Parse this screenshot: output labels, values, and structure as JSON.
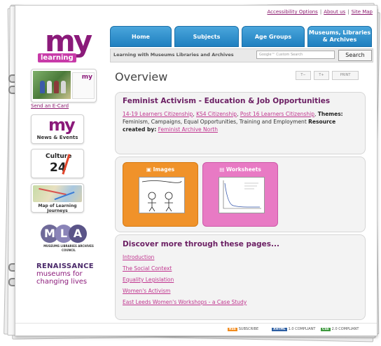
{
  "utility": {
    "accessibility": "Accessibility Options",
    "about": "About us",
    "sitemap": "Site Map",
    "sep": "|"
  },
  "logo": {
    "m": "my",
    "learning": "learning"
  },
  "sidebar": {
    "ecard_link": "Send an E-Card",
    "news_logo": "my",
    "news_label": "News & Events",
    "culture_top": "Culture",
    "culture_num": "24",
    "map_label": "Map of Learning Journeys",
    "mla_letters": [
      "M",
      "L",
      "A"
    ],
    "mla_sub": "MUSEUMS LIBRARIES ARCHIVES",
    "mla_sub2": "COUNCIL",
    "renaissance_title": "RENAISSANCE",
    "renaissance_line1": "museums for",
    "renaissance_line2": "changing lives"
  },
  "nav": {
    "tabs": [
      "Home",
      "Subjects",
      "Age Groups",
      "Museums, Libraries & Archives"
    ]
  },
  "subbar": {
    "text": "Learning with Museums Libraries and Archives",
    "search_placeholder": "Google™ Custom Search",
    "search_button": "Search"
  },
  "main": {
    "title": "Overview",
    "tools": [
      "T−",
      "T+",
      "PRINT"
    ],
    "resource": {
      "heading": "Feminist Activism - Education & Job Opportunities",
      "links": [
        "14-19 Learners Citizenship",
        "KS4 Citizenship",
        "Post 16 Learners Citizenship"
      ],
      "themes_label": "Themes:",
      "themes_text": "Feminism, Campaigns, Equal Opportunities, Training and Employment",
      "created_label": "Resource created by:",
      "created_link": "Feminist Archive North"
    },
    "cards": [
      {
        "title": "Images"
      },
      {
        "title": "Worksheets"
      }
    ],
    "discover": {
      "heading": "Discover more through these pages...",
      "links": [
        "Introduction",
        "The Social Context",
        "Equality Legislation",
        "Women's Activism",
        "East Leeds Women's Workshops - a Case Study"
      ]
    }
  },
  "footer": {
    "rss": "RSS",
    "subscribe": "SUBSCRIBE",
    "xhtml": "XHTML",
    "xhtml_text": "1.0 COMPLIANT",
    "css": "CSS",
    "css_text": "2.0 COMPLIANT"
  },
  "colors": {
    "brand": "#8b1a7a",
    "tab": "#2a8ccf",
    "link": "#c0368f",
    "images": "#f0922a",
    "worksheets": "#e87ac4"
  }
}
